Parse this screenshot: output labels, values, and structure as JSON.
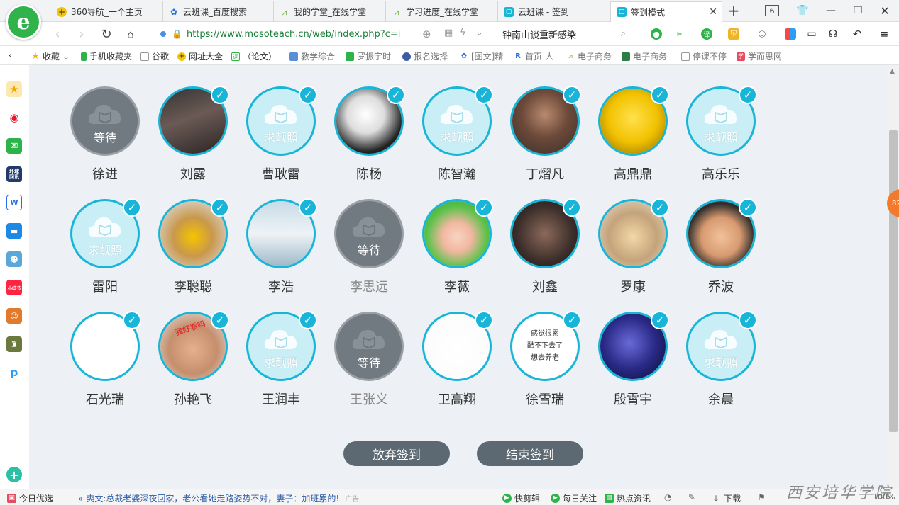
{
  "browser": {
    "logo": "e",
    "tabs": [
      {
        "label": "360导航_一个主页",
        "icon": "360-icon"
      },
      {
        "label": "云班课_百度搜索",
        "icon": "baidu-paw-icon"
      },
      {
        "label": "我的学堂_在线学堂",
        "icon": "xuetang-icon"
      },
      {
        "label": "学习进度_在线学堂",
        "icon": "xuetang-icon"
      },
      {
        "label": "云班课 - 签到",
        "icon": "yunbanke-icon"
      },
      {
        "label": "签到模式",
        "icon": "yunbanke-icon"
      }
    ],
    "tab_count": "6",
    "url": "https://www.mosoteach.cn/web/index.php?c=i",
    "search_text": "钟南山谈重新感染",
    "colors": {
      "accent": "#17b5d8",
      "wait": "#707a80",
      "button": "#5d6972",
      "logo": "#2fb34a"
    }
  },
  "bookmarks": [
    {
      "label": "收藏",
      "icon": "star-icon"
    },
    {
      "label": "手机收藏夹",
      "icon": "phone-icon"
    },
    {
      "label": "谷歌",
      "icon": "page-icon"
    },
    {
      "label": "网址大全",
      "icon": "360-icon"
    },
    {
      "label": "（论文）",
      "icon": "doc-icon"
    },
    {
      "label": "教学综合",
      "icon": "cube-icon"
    },
    {
      "label": "罗振宇时",
      "icon": "green-icon"
    },
    {
      "label": "报名选择",
      "icon": "globe-icon"
    },
    {
      "label": "[图文]精",
      "icon": "baidu-paw-icon"
    },
    {
      "label": "首页-人",
      "icon": "rw-icon"
    },
    {
      "label": "电子商务",
      "icon": "xuetang-icon"
    },
    {
      "label": "电子商务",
      "icon": "flag-icon"
    },
    {
      "label": "停课不停",
      "icon": "page-icon"
    },
    {
      "label": "学而思网",
      "icon": "xue-icon"
    }
  ],
  "sidebar_icons": [
    "star-icon",
    "weibo-icon",
    "mail-icon",
    "news-icon",
    "doc-icon",
    "chat-icon",
    "game-icon",
    "xiaohongshu-icon",
    "game2-icon",
    "game3-icon",
    "p-icon",
    "add-icon"
  ],
  "sidebar_labels": {
    "news": "环球\n网讯",
    "xhs": "小红书"
  },
  "students": [
    {
      "name": "徐进",
      "status": "wait",
      "caption": "等待",
      "checked": false
    },
    {
      "name": "刘露",
      "status": "photo",
      "caption": "",
      "checked": true
    },
    {
      "name": "曹耿雷",
      "status": "need",
      "caption": "求靓照",
      "checked": true
    },
    {
      "name": "陈杨",
      "status": "photo",
      "caption": "",
      "checked": true
    },
    {
      "name": "陈智瀚",
      "status": "need",
      "caption": "求靓照",
      "checked": true
    },
    {
      "name": "丁熠凡",
      "status": "photo",
      "caption": "",
      "checked": true
    },
    {
      "name": "高鼎鼎",
      "status": "photo",
      "caption": "",
      "checked": true
    },
    {
      "name": "高乐乐",
      "status": "need",
      "caption": "求靓照",
      "checked": true
    },
    {
      "name": "雷阳",
      "status": "need",
      "caption": "求靓照",
      "checked": true
    },
    {
      "name": "李聪聪",
      "status": "photo",
      "caption": "",
      "checked": true
    },
    {
      "name": "李浩",
      "status": "photo",
      "caption": "",
      "checked": true
    },
    {
      "name": "李思远",
      "status": "wait",
      "caption": "等待",
      "checked": false
    },
    {
      "name": "李薇",
      "status": "photo",
      "caption": "",
      "checked": true
    },
    {
      "name": "刘鑫",
      "status": "photo",
      "caption": "",
      "checked": true
    },
    {
      "name": "罗康",
      "status": "photo",
      "caption": "",
      "checked": true
    },
    {
      "name": "乔波",
      "status": "photo",
      "caption": "",
      "checked": true
    },
    {
      "name": "石光瑞",
      "status": "photo",
      "caption": "",
      "checked": true
    },
    {
      "name": "孙艳飞",
      "status": "photo",
      "caption": "我好看吗",
      "checked": true
    },
    {
      "name": "王润丰",
      "status": "need",
      "caption": "求靓照",
      "checked": true
    },
    {
      "name": "王张义",
      "status": "wait",
      "caption": "等待",
      "checked": false
    },
    {
      "name": "卫高翔",
      "status": "photo",
      "caption": "",
      "checked": true
    },
    {
      "name": "徐雪瑞",
      "status": "text",
      "caption": "感觉很累\n酷不下去了\n想去养老",
      "checked": true
    },
    {
      "name": "殷霄宇",
      "status": "photo",
      "caption": "",
      "checked": true
    },
    {
      "name": "余晨",
      "status": "need",
      "caption": "求靓照",
      "checked": true
    }
  ],
  "actions": {
    "abandon": "放弃签到",
    "finish": "结束签到"
  },
  "side_badge": "82",
  "status_bar": {
    "left": "今日优选",
    "news": "爽文:总裁老婆深夜回家，老公看她走路姿势不对，妻子：加班累的!",
    "news_tag": "广告",
    "items": [
      "快剪辑",
      "每日关注",
      "热点资讯",
      "下载"
    ],
    "zoom": "100%"
  },
  "watermark": "西安培华学院"
}
